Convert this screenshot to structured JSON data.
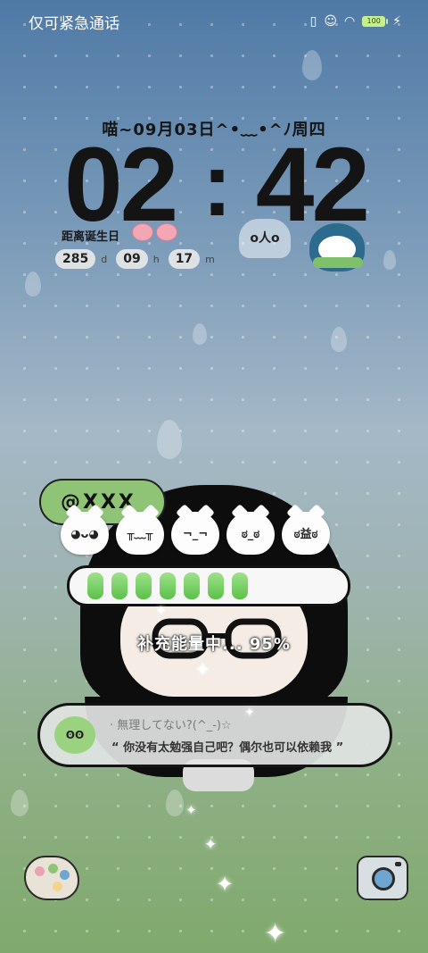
{
  "status_bar": {
    "left_text": "仅可紧急通话",
    "battery_label": "100"
  },
  "lockscreen": {
    "date_line": "喵~09月03日^•﹏•^ﾉ周四",
    "clock": {
      "hour": "02",
      "separator": ":",
      "minute": "42"
    },
    "birthday": {
      "label": "距离诞生日",
      "days": "285",
      "days_unit": "d",
      "hours": "09",
      "hours_unit": "h",
      "minutes": "17",
      "minutes_unit": "m"
    },
    "bubble_face": "o人o"
  },
  "widget": {
    "username": "@XXX",
    "emoji_faces": [
      "◕ᴗ◕",
      "╥﹏╥",
      "¬_¬",
      "ಠ_ಠ",
      "ಠ益ಠ"
    ],
    "charge_text": "补充能量中... 95%",
    "charge_level": 0.95,
    "message": {
      "avatar_face": "ʘʘ",
      "subtitle": "· 無理してない?(^_-)☆",
      "text": "“ 你没有太勉强自己吧？偶尔也可以依赖我 ”"
    }
  },
  "icons": {
    "left_shortcut": "palette-icon",
    "right_shortcut": "camera-icon",
    "status": [
      "vibrate-icon",
      "message-icon",
      "wifi-icon",
      "battery-icon",
      "charging-icon"
    ]
  },
  "colors": {
    "accent_green": "#8fc477",
    "progress_green": "#5cc04a",
    "battery": "#c7f08b"
  }
}
